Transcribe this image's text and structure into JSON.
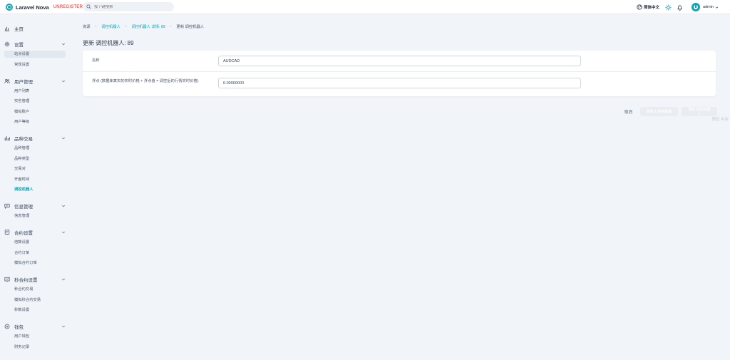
{
  "brand": {
    "name": "Laravel Nova",
    "tag": "UNREGISTERED"
  },
  "search": {
    "placeholder": "按 / 键搜索"
  },
  "topbar": {
    "language": "简体中文",
    "user": "admin"
  },
  "watermark": "预览 中央",
  "sidebar": {
    "sections": [
      {
        "label": "主页",
        "icon": "bar-chart-icon"
      },
      {
        "label": "设置",
        "icon": "gear-icon",
        "items": [
          "站点设置",
          "常规设置"
        ]
      },
      {
        "label": "用户管理",
        "icon": "users-icon",
        "items": [
          "用户列表",
          "实名管理",
          "模拟账户",
          "用户等级"
        ]
      },
      {
        "label": "品种交易",
        "icon": "chart-bars-icon",
        "items": [
          "品种管理",
          "品种类型",
          "交易对",
          "开盘时间",
          "调控机器人"
        ]
      },
      {
        "label": "信息管理",
        "icon": "message-icon",
        "items": [
          "信息管理"
        ]
      },
      {
        "label": "合约设置",
        "icon": "contract-icon",
        "items": [
          "倍数设置",
          "合约订单",
          "模拟合约订单"
        ]
      },
      {
        "label": "秒合约设置",
        "icon": "seconds-contract-icon",
        "items": [
          "秒合约交易",
          "模拟秒合约交易",
          "秒数设置"
        ]
      },
      {
        "label": "钱包",
        "icon": "wallet-icon",
        "items": [
          "用户钱包",
          "财务记录"
        ]
      }
    ]
  },
  "breadcrumb": [
    "资源",
    "调控机器人",
    "调控机器人 详情: 89",
    "更新 调控机器人"
  ],
  "page": {
    "title": "更新 调控机器人: 89"
  },
  "form": {
    "name_label": "名称",
    "name_value": "AUDCAD",
    "float_label": "浮点 (数据库真实的实时价格 + 浮点值 = 调控后的行情实时价格)",
    "float_value": "0.00000000"
  },
  "actions": {
    "cancel": "取消",
    "update_continue": "更新 & 继续编辑",
    "update": "更新 调控机器人"
  }
}
